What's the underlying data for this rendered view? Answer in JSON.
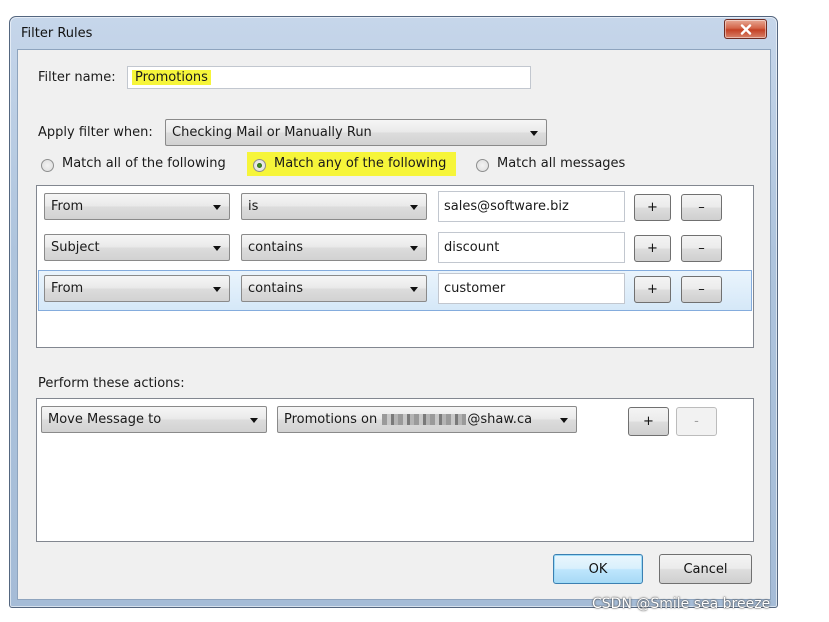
{
  "window": {
    "title": "Filter Rules"
  },
  "filter_name": {
    "label": "Filter name:",
    "value": "Promotions"
  },
  "apply_when": {
    "label": "Apply filter when:",
    "value": "Checking Mail or Manually Run"
  },
  "match": {
    "options": [
      "Match all of the following",
      "Match any of the following",
      "Match all messages"
    ],
    "selected": "Match any of the following"
  },
  "rules": [
    {
      "field": "From",
      "operator": "is",
      "value": "sales@software.biz"
    },
    {
      "field": "Subject",
      "operator": "contains",
      "value": "discount"
    },
    {
      "field": "From",
      "operator": "contains",
      "value": "customer"
    }
  ],
  "rule_buttons": {
    "add": "+",
    "remove": "–"
  },
  "actions": {
    "label": "Perform these actions:",
    "items": [
      {
        "action": "Move Message to",
        "target_prefix": "Promotions on",
        "target_suffix": "@shaw.ca"
      }
    ],
    "add": "+",
    "remove": "-"
  },
  "footer": {
    "ok": "OK",
    "cancel": "Cancel"
  },
  "watermark": "CSDN @Smile sea breeze",
  "icons": {
    "close": "close-icon",
    "dropdown": "chevron-down-icon"
  },
  "colors": {
    "highlight": "#f6f53a",
    "selected_row": "#d5e8f8",
    "close_button": "#c44125"
  }
}
